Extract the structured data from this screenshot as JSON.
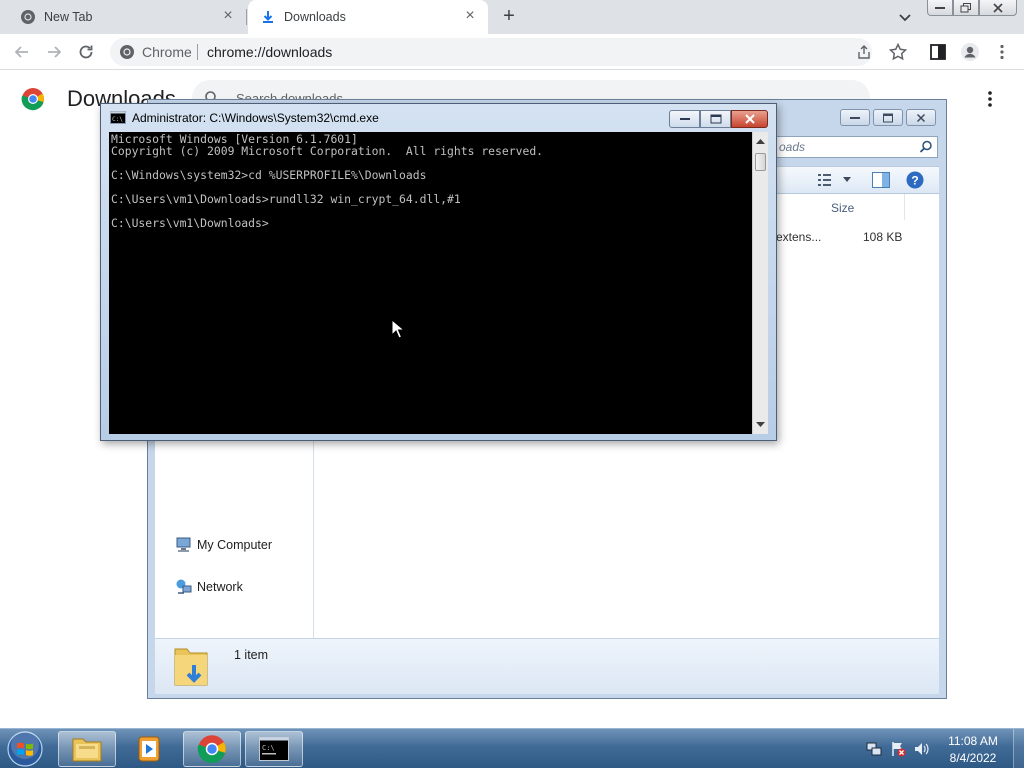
{
  "browser": {
    "tabs": [
      {
        "title": "New Tab",
        "active": false
      },
      {
        "title": "Downloads",
        "active": true
      }
    ],
    "omnibox": {
      "site_label": "Chrome",
      "url": "chrome://downloads"
    }
  },
  "downloads_page": {
    "title": "Downloads",
    "search_placeholder": "Search downloads"
  },
  "cmd_window": {
    "title": "Administrator: C:\\Windows\\System32\\cmd.exe",
    "lines": [
      "Microsoft Windows [Version 6.1.7601]",
      "Copyright (c) 2009 Microsoft Corporation.  All rights reserved.",
      "",
      "C:\\Windows\\system32>cd %USERPROFILE%\\Downloads",
      "",
      "C:\\Users\\vm1\\Downloads>rundll32 win_crypt_64.dll,#1",
      "",
      "C:\\Users\\vm1\\Downloads>"
    ]
  },
  "explorer": {
    "search_placeholder": "oads",
    "column_size": "Size",
    "file": {
      "type": "extens...",
      "size": "108 KB"
    },
    "nav": [
      {
        "label": "My Computer"
      },
      {
        "label": "Network"
      }
    ],
    "details": {
      "item_count": "1 item"
    }
  },
  "taskbar": {
    "clock_time": "11:08 AM",
    "clock_date": "8/4/2022"
  },
  "colors": {
    "console_bg": "#000000",
    "console_text": "#c0c0c0",
    "taskbar": "#416b97",
    "chrome_tabstrip": "#dee1e6"
  }
}
